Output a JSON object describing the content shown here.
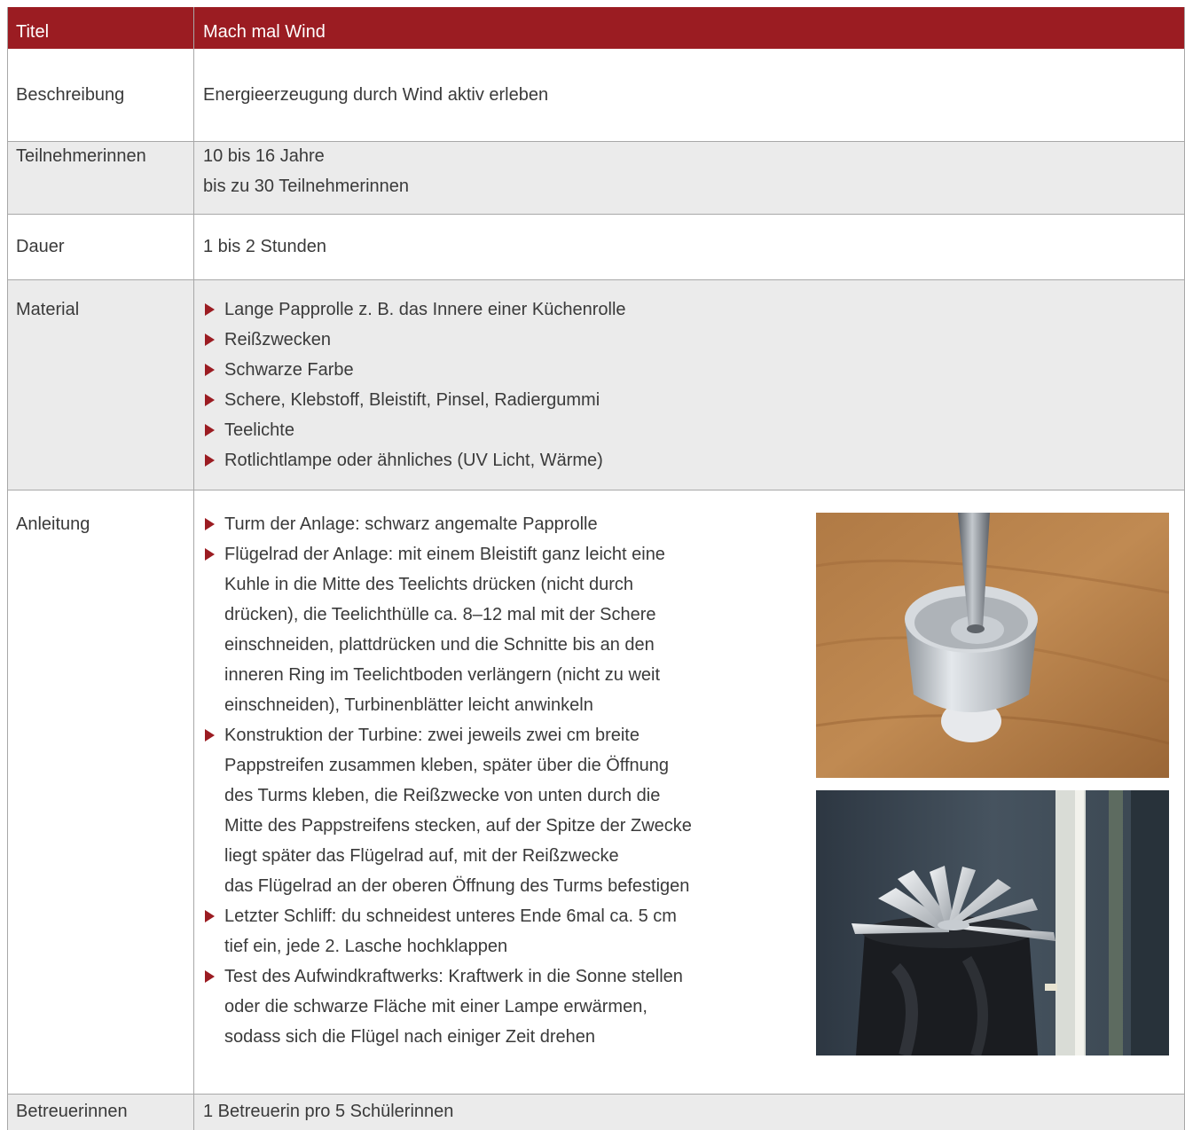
{
  "header": {
    "label": "Titel",
    "value": "Mach mal Wind"
  },
  "beschreibung": {
    "label": "Beschreibung",
    "value": "Energieerzeugung durch Wind aktiv erleben"
  },
  "teilnehmerinnen": {
    "label": "Teilnehmerinnen",
    "lines": [
      "10 bis 16 Jahre",
      "bis zu 30 Teilnehmerinnen"
    ]
  },
  "dauer": {
    "label": "Dauer",
    "value": "1 bis 2 Stunden"
  },
  "material": {
    "label": "Material",
    "items": [
      "Lange Papprolle z. B. das Innere einer Küchenrolle",
      "Reißzwecken",
      "Schwarze Farbe",
      "Schere, Klebstoff, Bleistift, Pinsel, Radiergummi",
      "Teelichte",
      "Rotlichtlampe oder ähnliches (UV Licht, Wärme)"
    ]
  },
  "anleitung": {
    "label": "Anleitung",
    "items": [
      {
        "lines": [
          "Turm der Anlage: schwarz angemalte Papprolle"
        ]
      },
      {
        "lines": [
          "Flügelrad der Anlage: mit einem Bleistift ganz leicht eine",
          "Kuhle in die Mitte des Teelichts drücken (nicht durch",
          "drücken), die Teelichthülle ca. 8–12 mal mit der Schere",
          "einschneiden, plattdrücken und die Schnitte bis an den",
          "inneren Ring im Teelichtboden verlängern (nicht zu weit",
          "einschneiden), Turbinenblätter leicht anwinkeln"
        ]
      },
      {
        "lines": [
          "Konstruktion der Turbine: zwei jeweils zwei cm breite",
          "Pappstreifen zusammen kleben, später über die Öffnung",
          "des Turms kleben, die Reißzwecke von unten durch die",
          "Mitte des Pappstreifens stecken, auf der Spitze der Zwecke",
          "liegt später das Flügelrad auf, mit der Reißzwecke",
          "das Flügelrad an der oberen Öffnung des Turms befestigen"
        ]
      },
      {
        "lines": [
          "Letzter Schliff: du schneidest unteres Ende 6mal ca. 5 cm",
          "tief ein, jede 2. Lasche hochklappen"
        ]
      },
      {
        "lines": [
          "Test des Aufwindkraftwerks: Kraftwerk in die Sonne stellen",
          "oder die schwarze Fläche mit einer Lampe erwärmen,",
          "sodass sich die Flügel nach einiger Zeit drehen"
        ]
      }
    ]
  },
  "betreuerinnen": {
    "label": "Betreuerinnen",
    "value": "1 Betreuerin pro 5 Schülerinnen"
  },
  "colors": {
    "header_bg": "#9b1c22",
    "bullet": "#9b1c22",
    "row_alt": "#ebebeb",
    "rule": "#a8a8a8"
  }
}
